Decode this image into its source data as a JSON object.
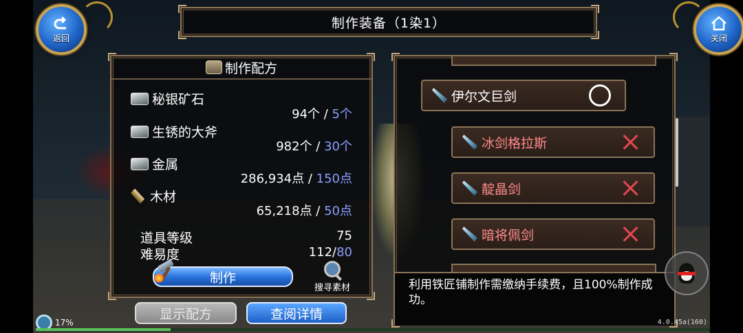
{
  "header": {
    "title": "制作装备（1染1）",
    "back_label": "返回",
    "close_label": "关闭"
  },
  "recipe": {
    "heading": "制作配方",
    "materials": [
      {
        "name": "秘银矿石",
        "have": "94个",
        "need": "5个",
        "icon": "ore-icon"
      },
      {
        "name": "生锈的大斧",
        "have": "982个",
        "need": "30个",
        "icon": "ore-icon"
      },
      {
        "name": "金属",
        "have": "286,934点",
        "need": "150点",
        "icon": "ore-icon"
      },
      {
        "name": "木材",
        "have": "65,218点",
        "need": "50点",
        "icon": "wood-icon"
      }
    ],
    "item_level_label": "道具等级",
    "item_level_value": "75",
    "difficulty_label": "难易度",
    "difficulty_have": "112/",
    "difficulty_need": "80",
    "craft_label": "制作",
    "search_label": "搜寻素材"
  },
  "buttons": {
    "show_recipe": "显示配方",
    "view_details": "查阅详情"
  },
  "equipment_list": [
    {
      "name": "伊尔文巨剑",
      "status": "available",
      "mark": "circle"
    },
    {
      "name": "冰剑格拉斯",
      "status": "unavailable",
      "mark": "x"
    },
    {
      "name": "靛晶剑",
      "status": "unavailable",
      "mark": "x"
    },
    {
      "name": "暗将佩剑",
      "status": "unavailable",
      "mark": "x"
    }
  ],
  "description": "利用铁匠铺制作需缴纳手续费，且100%制作成功。",
  "status": {
    "network": "17%",
    "version": "4.0.45a(160)"
  },
  "colors": {
    "accent_blue": "#8aa0ff",
    "unavailable_red": "#ff8a8a",
    "frame_gold": "#8b7457"
  }
}
